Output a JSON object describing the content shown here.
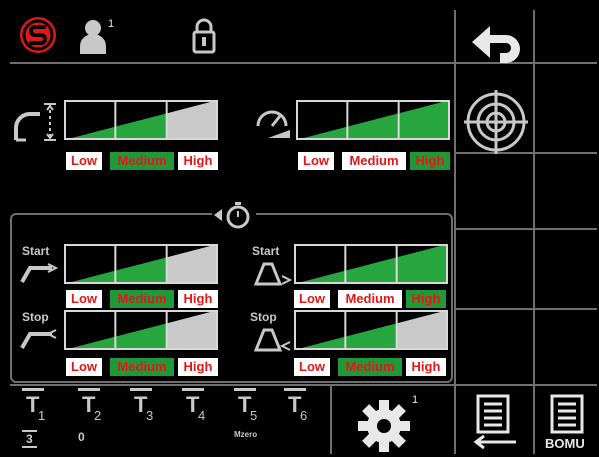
{
  "header": {
    "user_level": "1",
    "settings_level": "1"
  },
  "level_labels": {
    "low": "Low",
    "medium": "Medium",
    "high": "High"
  },
  "controls": {
    "force": {
      "selected": "medium"
    },
    "speed": {
      "selected": "high"
    },
    "start_1": {
      "label": "Start",
      "selected": "medium"
    },
    "start_2": {
      "label": "Start",
      "selected": "high"
    },
    "stop_1": {
      "label": "Stop",
      "selected": "medium"
    },
    "stop_2": {
      "label": "Stop",
      "selected": "medium"
    }
  },
  "tools": [
    {
      "name": "T",
      "index": "1",
      "sub": "3"
    },
    {
      "name": "T",
      "index": "2",
      "sub": "0"
    },
    {
      "name": "T",
      "index": "3",
      "sub": ""
    },
    {
      "name": "T",
      "index": "4",
      "sub": ""
    },
    {
      "name": "T",
      "index": "5",
      "sub": "Mzero"
    },
    {
      "name": "T",
      "index": "6",
      "sub": ""
    }
  ],
  "watermark": "BOMU",
  "colors": {
    "accent_red": "#e01818",
    "active_green": "#1e9a3a",
    "grid": "#6f6f6f",
    "bar_fill_green": "#27a53f",
    "bar_fill_gray": "#c9c9c9"
  }
}
